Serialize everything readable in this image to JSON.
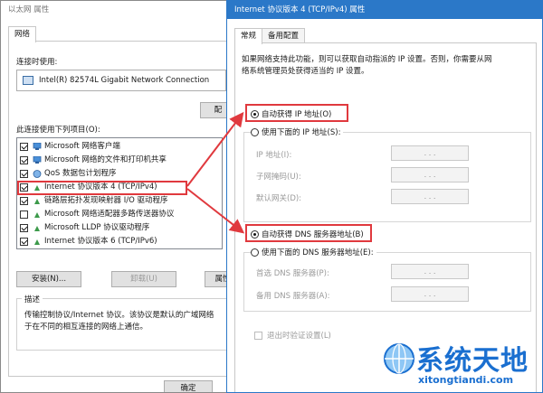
{
  "bg_window": {
    "title": "以太网 属性",
    "tab": "网络",
    "connect_using_label": "连接时使用:",
    "adapter_name": "Intel(R) 82574L Gigabit Network Connection",
    "configure_button": "配",
    "items_label": "此连接使用下列项目(O):",
    "items": [
      {
        "label": "Microsoft 网络客户端",
        "checked": true,
        "icon": "network-client-icon"
      },
      {
        "label": "Microsoft 网络的文件和打印机共享",
        "checked": true,
        "icon": "file-printer-share-icon"
      },
      {
        "label": "QoS 数据包计划程序",
        "checked": true,
        "icon": "qos-icon"
      },
      {
        "label": "Internet 协议版本 4 (TCP/IPv4)",
        "checked": true,
        "icon": "protocol-icon"
      },
      {
        "label": "链路层拓扑发现映射器 I/O 驱动程序",
        "checked": false,
        "icon": "protocol-icon"
      },
      {
        "label": "Microsoft 网络适配器多路传送器协议",
        "checked": false,
        "icon": "protocol-icon"
      },
      {
        "label": "Microsoft LLDP 协议驱动程序",
        "checked": true,
        "icon": "protocol-icon"
      },
      {
        "label": "Internet 协议版本 6 (TCP/IPv6)",
        "checked": true,
        "icon": "protocol-icon"
      }
    ],
    "install_button": "安装(N)...",
    "uninstall_button": "卸载(U)",
    "properties_button": "属性",
    "description_title": "描述",
    "description_line1": "传输控制协议/Internet 协议。该协议是默认的广域网络",
    "description_line2": "于在不同的相互连接的网络上通信。",
    "ok_button": "确定"
  },
  "fg_window": {
    "title": "Internet 协议版本 4 (TCP/IPv4) 属性",
    "tabs": [
      "常规",
      "备用配置"
    ],
    "intro_line1": "如果网络支持此功能，则可以获取自动指派的 IP 设置。否则，你需要从网",
    "intro_line2": "络系统管理员处获得适当的 IP 设置。",
    "auto_ip": "自动获得 IP 地址(O)",
    "manual_ip": "使用下面的 IP 地址(S):",
    "ip_address_label": "IP 地址(I):",
    "subnet_label": "子网掩码(U):",
    "gateway_label": "默认网关(D):",
    "auto_dns": "自动获得 DNS 服务器地址(B)",
    "manual_dns": "使用下面的 DNS 服务器地址(E):",
    "preferred_dns_label": "首选 DNS 服务器(P):",
    "alternate_dns_label": "备用 DNS 服务器(A):",
    "validate_label": "退出时验证设置(L)",
    "ip_dots": ". . ."
  },
  "watermark": {
    "text": "系统天地",
    "url": "xitongtiandi.com"
  },
  "colors": {
    "highlight_red": "#e0393e",
    "watermark_blue": "#1a6fd0"
  }
}
